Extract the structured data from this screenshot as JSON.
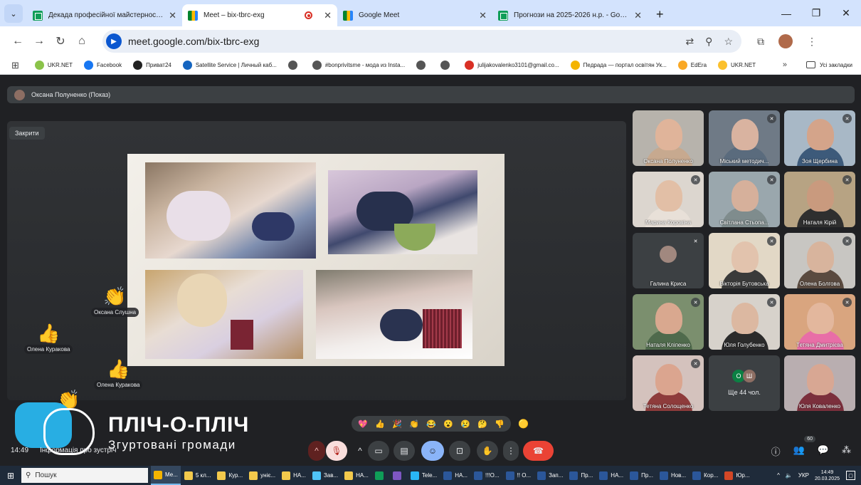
{
  "browser": {
    "tabs": [
      {
        "title": "Декада професійної майстерності - Google Т...",
        "icon": "sheets-icon",
        "active": false
      },
      {
        "title": "Meet – bix-tbrc-exg",
        "icon": "meet-icon",
        "active": true
      },
      {
        "title": "Google Meet",
        "icon": "meet-icon",
        "active": false
      },
      {
        "title": "Прогнози на 2025-2026 н.р. - Google Таблиці",
        "icon": "sheets-icon",
        "active": false
      }
    ],
    "url": "meet.google.com/bix-tbrc-exg",
    "bookmarks": [
      {
        "label": "UKR.NET",
        "color": "#8bc34a"
      },
      {
        "label": "Facebook",
        "color": "#1877f2"
      },
      {
        "label": "Приват24",
        "color": "#222222"
      },
      {
        "label": "Satellite Service | Личный каб...",
        "color": "#1565c0"
      },
      {
        "label": "",
        "color": "#555555"
      },
      {
        "label": "#bonprivitsme - мода из Insta...",
        "color": "#555555"
      },
      {
        "label": "",
        "color": "#555555"
      },
      {
        "label": "",
        "color": "#555555"
      },
      {
        "label": "julijakovalenko3101@gmail.co...",
        "color": "#d93025"
      },
      {
        "label": "Педрада — портал освітян Ук...",
        "color": "#f4b400"
      },
      {
        "label": "EdEra",
        "color": "#f9a825"
      },
      {
        "label": "UKR.NET",
        "color": "#fbc02d"
      }
    ],
    "all_bookmarks": "Усі закладки"
  },
  "meet": {
    "presenter": "Оксана Полуненко (Показ)",
    "close_label": "Закрити",
    "reactions": [
      {
        "emoji": "👏",
        "name": "Оксана Слушна"
      },
      {
        "emoji": "👍",
        "name": "Олена Куракова"
      },
      {
        "emoji": "👍",
        "name": "Олена Куракова"
      },
      {
        "emoji": "👏",
        "name": ""
      }
    ],
    "participants": [
      {
        "name": "Оксана Полуненко",
        "muted": false,
        "skin": "#e0b49a",
        "shirt": "#c7a98f",
        "bg": "#b7b3ac"
      },
      {
        "name": "Міський методич...",
        "muted": true,
        "skin": "#d9b3a0",
        "shirt": "#5a6b7d",
        "bg": "#6f7a86"
      },
      {
        "name": "Зоя Щербина",
        "muted": true,
        "skin": "#d4a48a",
        "shirt": "#3d5a7a",
        "bg": "#a8b8c6"
      },
      {
        "name": "Марина Коровіна",
        "muted": true,
        "skin": "#e2bfa6",
        "shirt": "#e8e0d8",
        "bg": "#dcd6cf"
      },
      {
        "name": "Світлана Стьопа...",
        "muted": true,
        "skin": "#d6b09b",
        "shirt": "#7f8c8d",
        "bg": "#9aa7ad"
      },
      {
        "name": "Наталя Кірій",
        "muted": true,
        "skin": "#c99a7e",
        "shirt": "#2f2f2f",
        "bg": "#b7a383"
      },
      {
        "name": "Галина Криса",
        "muted": true,
        "skin": "",
        "shirt": "",
        "bg": "#3c4043",
        "avatar": true
      },
      {
        "name": "Вікторія Бутовська",
        "muted": true,
        "skin": "#e2c3ad",
        "shirt": "#3a3a3a",
        "bg": "#e2d8c6"
      },
      {
        "name": "Олена Болгова",
        "muted": true,
        "skin": "#d8b49d",
        "shirt": "#5a4a3f",
        "bg": "#c8c6c2"
      },
      {
        "name": "Наталя Кліпенко",
        "muted": true,
        "skin": "#d9a88f",
        "shirt": "#4f6a4c",
        "bg": "#7b8f6e"
      },
      {
        "name": "Юля Голубенко",
        "muted": true,
        "skin": "#dcb8a1",
        "shirt": "#2b2b2b",
        "bg": "#d7d2cb"
      },
      {
        "name": "Тетяна Дмитрієва",
        "muted": true,
        "skin": "#e3b79d",
        "shirt": "#e86ea7",
        "bg": "#d9a57f"
      },
      {
        "name": "Тетяна Солощенко",
        "muted": true,
        "skin": "#dba58f",
        "shirt": "#8e3b3b",
        "bg": "#d4c2bd"
      },
      {
        "name": "Юля Коваленко",
        "muted": false,
        "skin": "#d8a793",
        "shirt": "#7b2f3c",
        "bg": "#b9aeb0"
      }
    ],
    "more": {
      "chips": [
        "О",
        "Ш"
      ],
      "label": "Ще 44 чол."
    },
    "emoji_bar": [
      "💖",
      "👍",
      "🎉",
      "👏",
      "😂",
      "😮",
      "😢",
      "🤔",
      "👎"
    ],
    "emoji_extra": "🟡",
    "clock": "14:49",
    "meeting_info": "Інформація про зустріч",
    "participants_badge": "60",
    "logo": {
      "title": "ПЛІЧ-О-ПЛІЧ",
      "subtitle": "Згуртовані громади"
    }
  },
  "taskbar": {
    "search": "Пошук",
    "items": [
      {
        "label": "Ме...",
        "color": "#f4b400",
        "active": true
      },
      {
        "label": "5 кл...",
        "color": "#f2c94c"
      },
      {
        "label": "Кур...",
        "color": "#f2c94c"
      },
      {
        "label": "уніє...",
        "color": "#f2c94c"
      },
      {
        "label": "НА...",
        "color": "#f2c94c"
      },
      {
        "label": "Зав...",
        "color": "#4fc3f7"
      },
      {
        "label": "НА...",
        "color": "#f2c94c"
      },
      {
        "label": "",
        "color": "#0f9d58"
      },
      {
        "label": "",
        "color": "#7e57c2"
      },
      {
        "label": "Tele...",
        "color": "#29b6f6"
      },
      {
        "label": "НА...",
        "color": "#2b579a"
      },
      {
        "label": "!!!О...",
        "color": "#2b579a"
      },
      {
        "label": "!! О...",
        "color": "#2b579a"
      },
      {
        "label": "Зап...",
        "color": "#2b579a"
      },
      {
        "label": "Пр...",
        "color": "#2b579a"
      },
      {
        "label": "НА...",
        "color": "#2b579a"
      },
      {
        "label": "Пр...",
        "color": "#2b579a"
      },
      {
        "label": "Нов...",
        "color": "#2b579a"
      },
      {
        "label": "Кор...",
        "color": "#2b579a"
      },
      {
        "label": "Юр...",
        "color": "#d24726"
      }
    ],
    "lang": "УКР",
    "time": "14:49",
    "date": "20.03.2025"
  }
}
